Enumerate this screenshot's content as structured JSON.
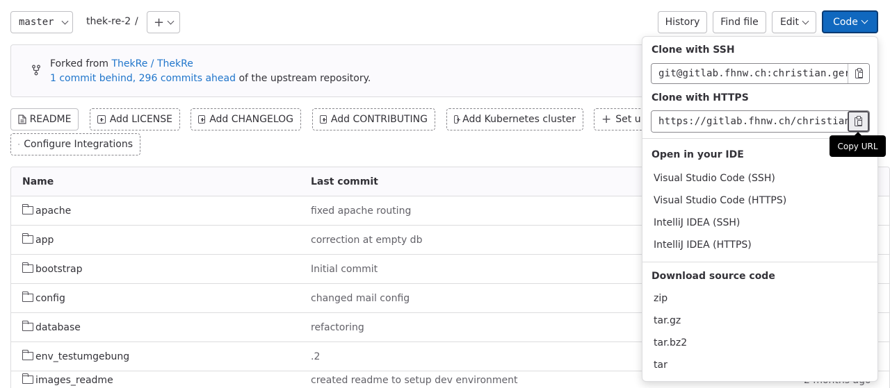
{
  "topbar": {
    "branch": "master",
    "repo": "thek-re-2",
    "separator": "/",
    "add_symbol": "+",
    "history": "History",
    "find_file": "Find file",
    "edit": "Edit",
    "code": "Code"
  },
  "fork": {
    "prefix": "Forked from",
    "source": "ThekRe / ThekRe",
    "status_link": "1 commit behind, 296 commits ahead",
    "status_suffix": "of the upstream repository."
  },
  "actions": [
    {
      "label": "README"
    },
    {
      "label": "Add LICENSE"
    },
    {
      "label": "Add CHANGELOG"
    },
    {
      "label": "Add CONTRIBUTING"
    },
    {
      "label": "Add Kubernetes cluster"
    },
    {
      "label": "Set u"
    },
    {
      "label": "Configure Integrations"
    }
  ],
  "table": {
    "headers": {
      "name": "Name",
      "last_commit": "Last commit"
    },
    "rows": [
      {
        "name": "apache",
        "commit": "fixed apache routing"
      },
      {
        "name": "app",
        "commit": "correction at empty db"
      },
      {
        "name": "bootstrap",
        "commit": "Initial commit"
      },
      {
        "name": "config",
        "commit": "changed mail config"
      },
      {
        "name": "database",
        "commit": "refactoring"
      },
      {
        "name": "env_testumgebung",
        "commit": ".2"
      },
      {
        "name": "images_readme",
        "commit": "created readme to setup dev environment",
        "date": "2 months ago"
      }
    ]
  },
  "dropdown": {
    "ssh_heading": "Clone with SSH",
    "ssh_url": "git@gitlab.fhnw.ch:christian.ger",
    "https_heading": "Clone with HTTPS",
    "https_url": "https://gitlab.fhnw.ch/christian",
    "ide_heading": "Open in your IDE",
    "ide_items": [
      "Visual Studio Code (SSH)",
      "Visual Studio Code (HTTPS)",
      "IntelliJ IDEA (SSH)",
      "IntelliJ IDEA (HTTPS)"
    ],
    "download_heading": "Download source code",
    "download_items": [
      "zip",
      "tar.gz",
      "tar.bz2",
      "tar"
    ]
  },
  "tooltip": "Copy URL",
  "colors": {
    "primary": "#1f75cb",
    "code_button": "#1068bf",
    "link": "#1f75cb"
  }
}
